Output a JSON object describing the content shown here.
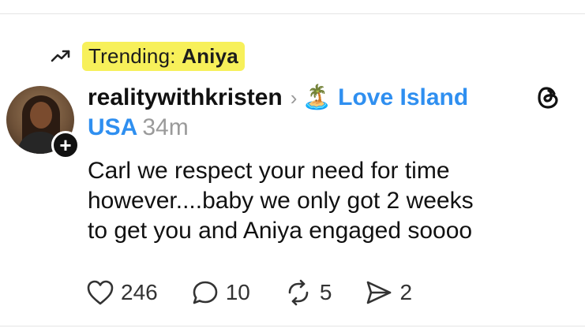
{
  "trending": {
    "prefix": "Trending: ",
    "topic": "Aniya",
    "icon": "trending-arrow-icon",
    "highlight_color": "#f7f05a"
  },
  "post": {
    "username": "realitywithkristen",
    "community_emoji": "🏝️",
    "community": "Love Island USA",
    "time": "34m",
    "text_lines": [
      "Carl we respect your need for time",
      "however....baby we only got 2 weeks",
      "to get you and Aniya engaged soooo"
    ],
    "link_color": "#2f8ff0"
  },
  "actions": {
    "likes": "246",
    "replies": "10",
    "reposts": "5",
    "shares": "2"
  }
}
